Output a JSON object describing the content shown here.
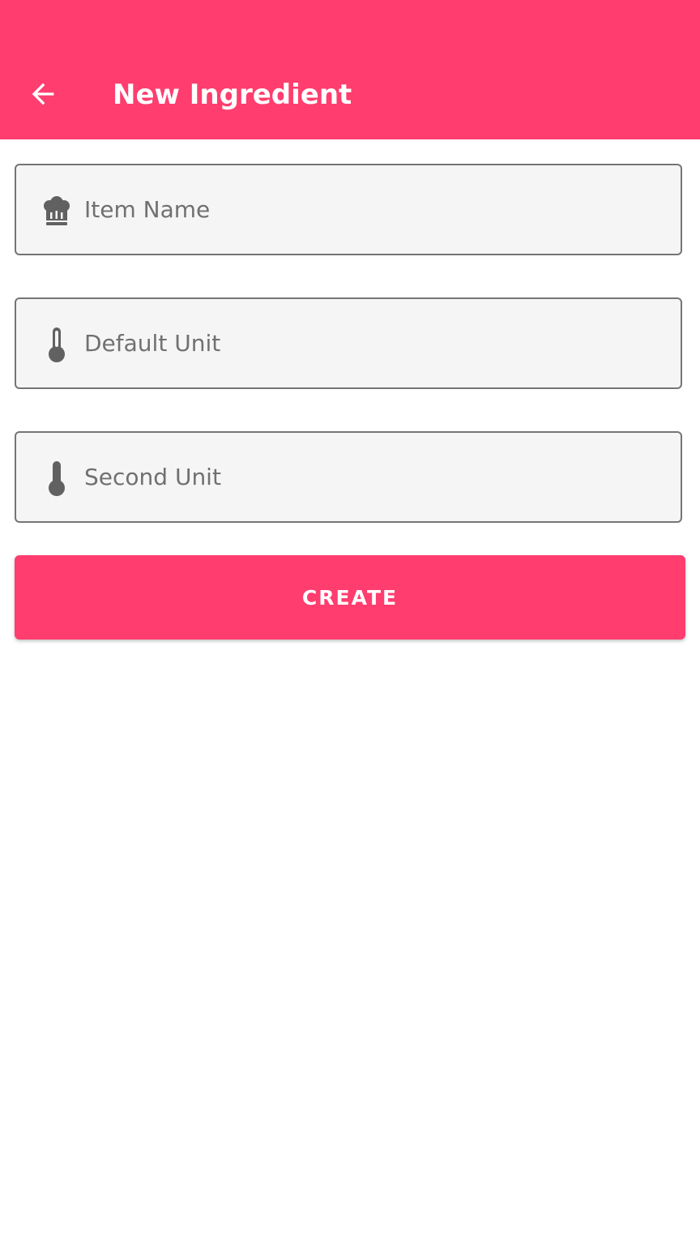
{
  "app_bar": {
    "title": "New Ingredient",
    "back_icon": "arrow-left-icon",
    "color": "#ff3d6e"
  },
  "form": {
    "item_name": {
      "placeholder": "Item Name",
      "value": "",
      "icon": "chef-hat-icon"
    },
    "default_unit": {
      "placeholder": "Default Unit",
      "value": "",
      "icon": "thermometer-icon"
    },
    "second_unit": {
      "placeholder": "Second Unit",
      "value": "",
      "icon": "thermometer-icon"
    }
  },
  "actions": {
    "create_label": "CREATE",
    "accent": "#ff3d6e"
  }
}
